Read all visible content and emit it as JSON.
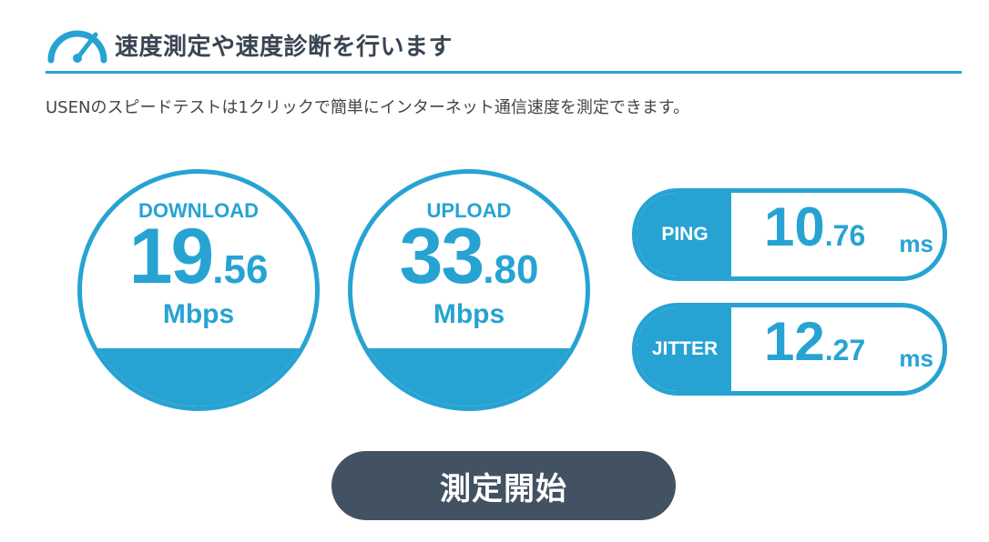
{
  "header": {
    "title": "速度測定や速度診断を行います",
    "accent_color": "#26a3d2",
    "icon": "speedometer-icon"
  },
  "description": "USENのスピードテストは1クリックで簡単にインターネット通信速度を測定できます。",
  "download": {
    "label": "DOWNLOAD",
    "int": "19",
    "dec": ".56",
    "unit": "Mbps"
  },
  "upload": {
    "label": "UPLOAD",
    "int": "33",
    "dec": ".80",
    "unit": "Mbps"
  },
  "ping": {
    "label": "PING",
    "int": "10",
    "dec": ".76",
    "unit": "ms"
  },
  "jitter": {
    "label": "JITTER",
    "int": "12",
    "dec": ".27",
    "unit": "ms"
  },
  "start_button": {
    "label": "測定開始",
    "color": "#435262"
  }
}
